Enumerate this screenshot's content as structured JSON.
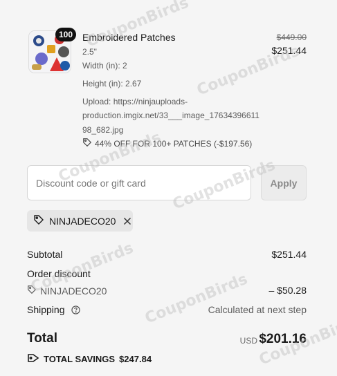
{
  "item": {
    "quantity": "100",
    "title": "Embroidered Patches",
    "size": "2.5\"",
    "width": "Width (in): 2",
    "height": "Height (in): 2.67",
    "upload_line1": "Upload: https://ninjauploads-",
    "upload_line2": "production.imgix.net/33___image_17634396611",
    "upload_line3": "98_682.jpg",
    "discount": "44% OFF FOR 100+ PATCHES (-$197.56)",
    "price_original": "$449.00",
    "price_current": "$251.44"
  },
  "discount_form": {
    "placeholder": "Discount code or gift card",
    "apply_label": "Apply"
  },
  "applied_code": "NINJADECO20",
  "summary": {
    "subtotal_label": "Subtotal",
    "subtotal_value": "$251.44",
    "order_discount_label": "Order discount",
    "order_discount_code": "NINJADECO20",
    "order_discount_value": "– $50.28",
    "shipping_label": "Shipping",
    "shipping_value": "Calculated at next step",
    "total_label": "Total",
    "currency": "USD",
    "total_value": "$201.16",
    "savings_label": "TOTAL SAVINGS",
    "savings_value": "$247.84"
  },
  "watermark": "CouponBirds"
}
